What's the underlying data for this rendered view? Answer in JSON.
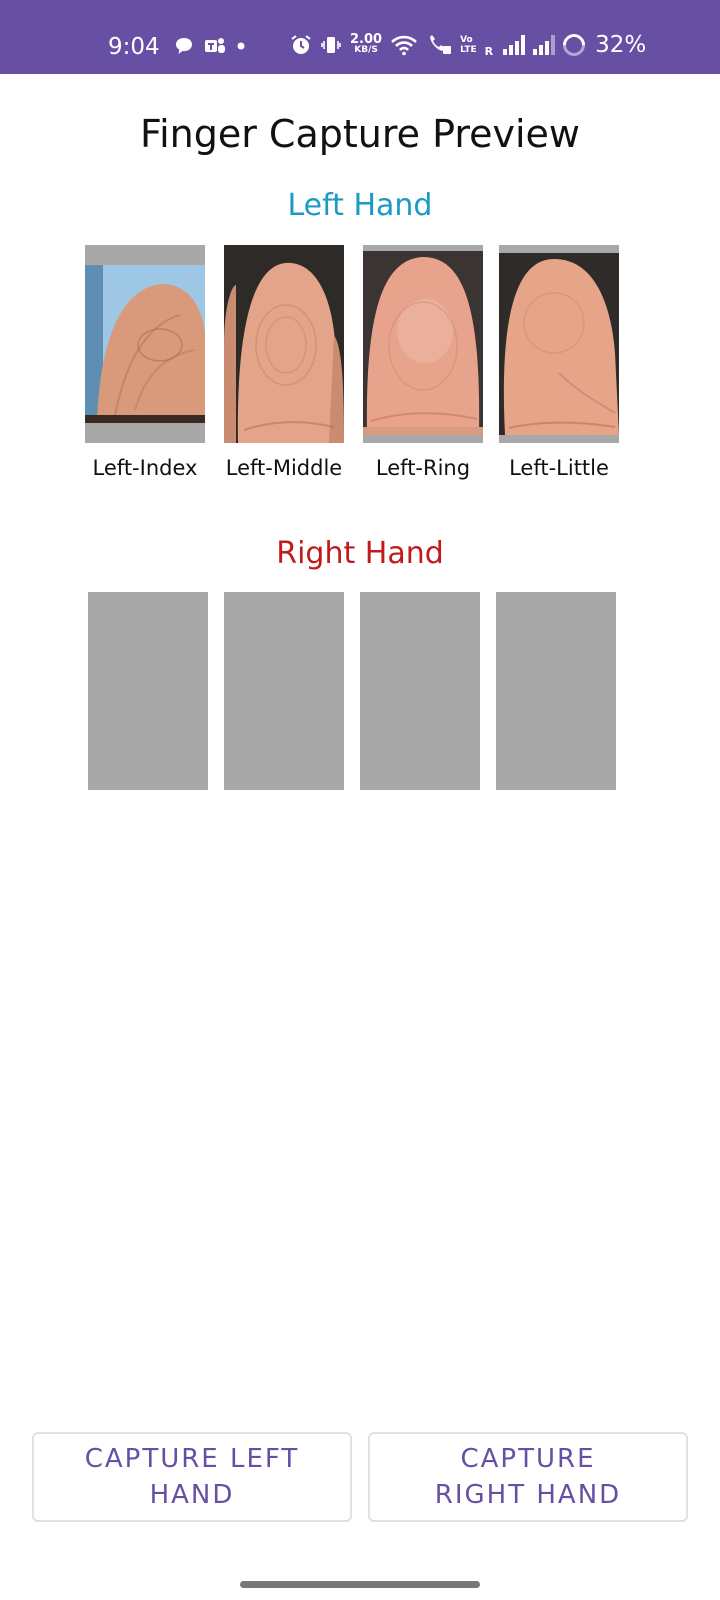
{
  "status_bar": {
    "time": "9:04",
    "left_icons": [
      "chat-bubble-icon",
      "teams-icon",
      "dot-icon"
    ],
    "net_speed_value": "2.00",
    "net_speed_unit": "KB/S",
    "volte_line1": "Vo",
    "volte_line2": "LTE",
    "roaming": "R",
    "battery_percent": "32%",
    "background_color": "#6750A4"
  },
  "title": "Finger Capture Preview",
  "left_hand": {
    "heading": "Left Hand",
    "heading_color": "#1C9AC4",
    "fingers": [
      {
        "label": "Left-Index"
      },
      {
        "label": "Left-Middle"
      },
      {
        "label": "Left-Ring"
      },
      {
        "label": "Left-Little"
      }
    ]
  },
  "right_hand": {
    "heading": "Right Hand",
    "heading_color": "#C01C1C"
  },
  "buttons": {
    "capture_left": "CAPTURE LEFT HAND",
    "capture_right": "CAPTURE RIGHT HAND",
    "text_color": "#6750A4"
  },
  "colors": {
    "placeholder_gray": "#A8A8A8"
  }
}
